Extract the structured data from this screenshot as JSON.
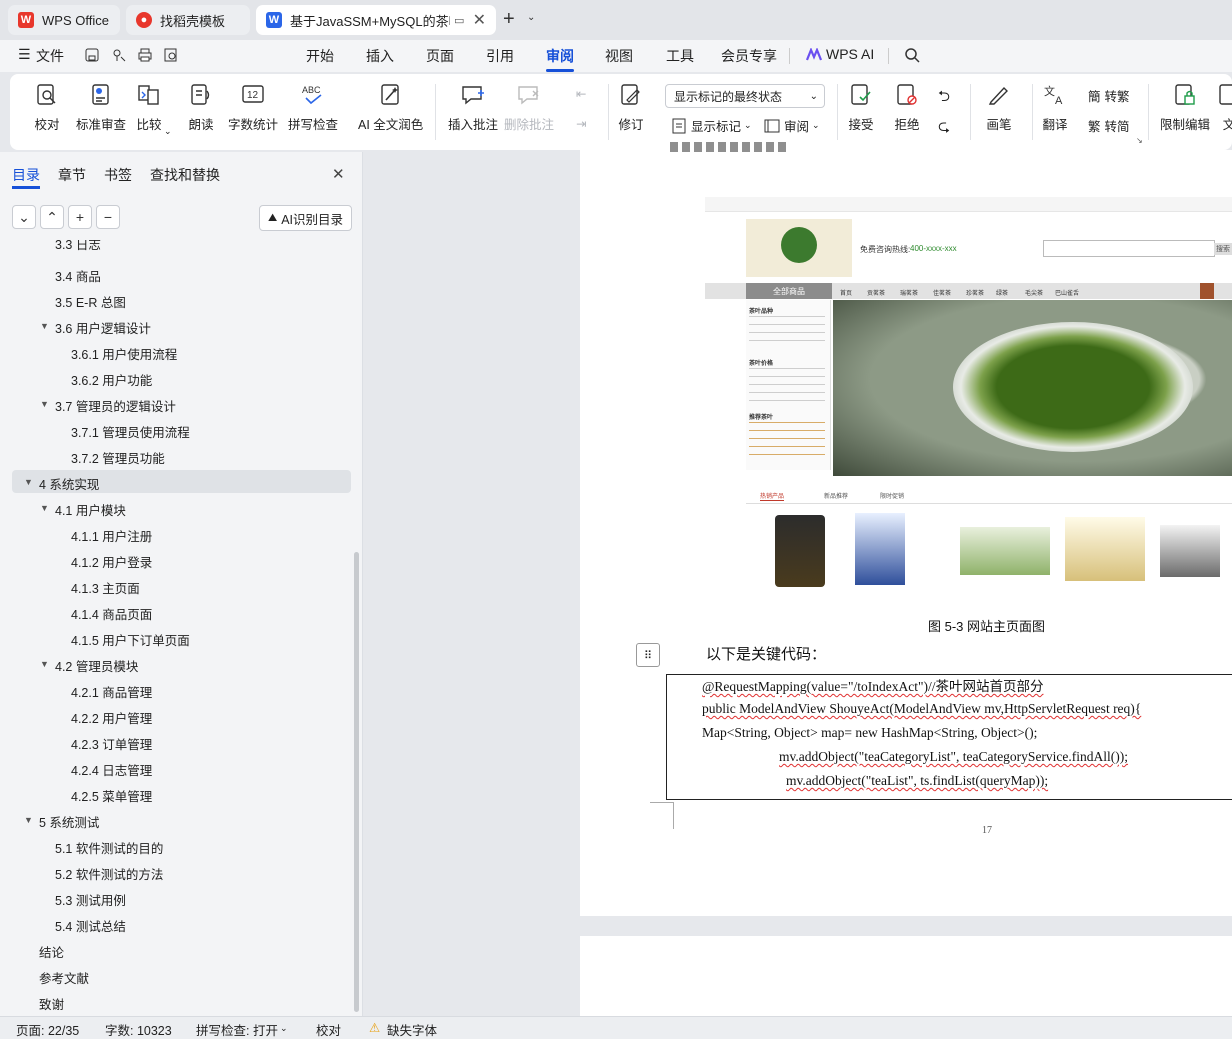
{
  "tabs": {
    "wps_office": "WPS Office",
    "template": "找稻壳模板",
    "document": "基于JavaSSM+MySQL的茶叶"
  },
  "menu": {
    "file": "文件",
    "items": [
      "开始",
      "插入",
      "页面",
      "引用",
      "审阅",
      "视图",
      "工具",
      "会员专享"
    ],
    "wps_ai": "WPS AI"
  },
  "ribbon": {
    "proofread": "校对",
    "standard_review": "标准审查",
    "compare": "比较",
    "read_aloud": "朗读",
    "word_count": "字数统计",
    "spell_check": "拼写检查",
    "ai_polish": "AI 全文润色",
    "insert_comment": "插入批注",
    "delete_comment": "删除批注",
    "track_changes": "修订",
    "markup_select": "显示标记的最终状态",
    "show_markup": "显示标记",
    "review_pane": "审阅",
    "accept": "接受",
    "reject": "拒绝",
    "pen": "画笔",
    "translate": "翻译",
    "to_traditional": "转繁",
    "to_simplified": "转简",
    "restrict_edit": "限制编辑",
    "doc_more": "文"
  },
  "nav": {
    "tabs": [
      "目录",
      "章节",
      "书签",
      "查找和替换"
    ],
    "ai_toc": "AI识别目录",
    "toc": [
      {
        "text": "3.3 日志",
        "level": 2
      },
      {
        "text": "3.4 商品",
        "level": 2
      },
      {
        "text": "3.5 E-R 总图",
        "level": 2
      },
      {
        "text": "3.6 用户逻辑设计",
        "level": 2,
        "expanded": true
      },
      {
        "text": "3.6.1 用户使用流程",
        "level": 3
      },
      {
        "text": "3.6.2 用户功能",
        "level": 3
      },
      {
        "text": "3.7 管理员的逻辑设计",
        "level": 2,
        "expanded": true
      },
      {
        "text": "3.7.1 管理员使用流程",
        "level": 3
      },
      {
        "text": "3.7.2 管理员功能",
        "level": 3
      },
      {
        "text": "4 系统实现",
        "level": 1,
        "expanded": true,
        "selected": true
      },
      {
        "text": "4.1 用户模块",
        "level": 2,
        "expanded": true
      },
      {
        "text": "4.1.1 用户注册",
        "level": 3
      },
      {
        "text": "4.1.2 用户登录",
        "level": 3
      },
      {
        "text": "4.1.3 主页面",
        "level": 3
      },
      {
        "text": "4.1.4 商品页面",
        "level": 3
      },
      {
        "text": "4.1.5 用户下订单页面",
        "level": 3
      },
      {
        "text": "4.2 管理员模块",
        "level": 2,
        "expanded": true
      },
      {
        "text": "4.2.1 商品管理",
        "level": 3
      },
      {
        "text": "4.2.2 用户管理",
        "level": 3
      },
      {
        "text": "4.2.3 订单管理",
        "level": 3
      },
      {
        "text": "4.2.4 日志管理",
        "level": 3
      },
      {
        "text": "4.2.5 菜单管理",
        "level": 3
      },
      {
        "text": "5 系统测试",
        "level": 1,
        "expanded": true
      },
      {
        "text": "5.1 软件测试的目的",
        "level": 2
      },
      {
        "text": "5.2 软件测试的方法",
        "level": 2
      },
      {
        "text": "5.3 测试用例",
        "level": 2
      },
      {
        "text": "5.4 测试总结",
        "level": 2
      },
      {
        "text": "结论",
        "level": 1
      },
      {
        "text": "参考文献",
        "level": 1
      },
      {
        "text": "致谢",
        "level": 1
      }
    ]
  },
  "document": {
    "figure_caption": "图 5-3 网站主页面图",
    "intro": "以下是关键代码：",
    "code": [
      "@RequestMapping(value=\"/toIndexAct\")//茶叶网站首页部分",
      "public ModelAndView ShouyeAct(ModelAndView mv,HttpServletRequest req){",
      "Map<String, Object> map= new HashMap<String, Object>();",
      "mv.addObject(\"teaCategoryList\", teaCategoryService.findAll());",
      "mv.addObject(\"teaList\", ts.findList(queryMap));"
    ],
    "page_number": "17",
    "shop": {
      "hotline_label": "免费咨询热线:",
      "hotline": "400-xxxx-xxx",
      "search_btn": "搜索",
      "all_goods": "全部商品",
      "nav": [
        "首页",
        "贡茗茶",
        "瑞茗茶",
        "佳茗茶",
        "珍茗茶",
        "绿茶",
        "毛尖茶",
        "巴山雀舌"
      ],
      "side_title_1": "茶叶品种",
      "side_title_2": "茶叶价格",
      "side_title_3": "推荐茶叶",
      "tabs": [
        "热销产品",
        "新品推荐",
        "限时促销"
      ]
    }
  },
  "status": {
    "page": "页面: 22/35",
    "words": "字数: 10323",
    "spell": "拼写检查: 打开",
    "proof": "校对",
    "missing_font": "缺失字体"
  }
}
